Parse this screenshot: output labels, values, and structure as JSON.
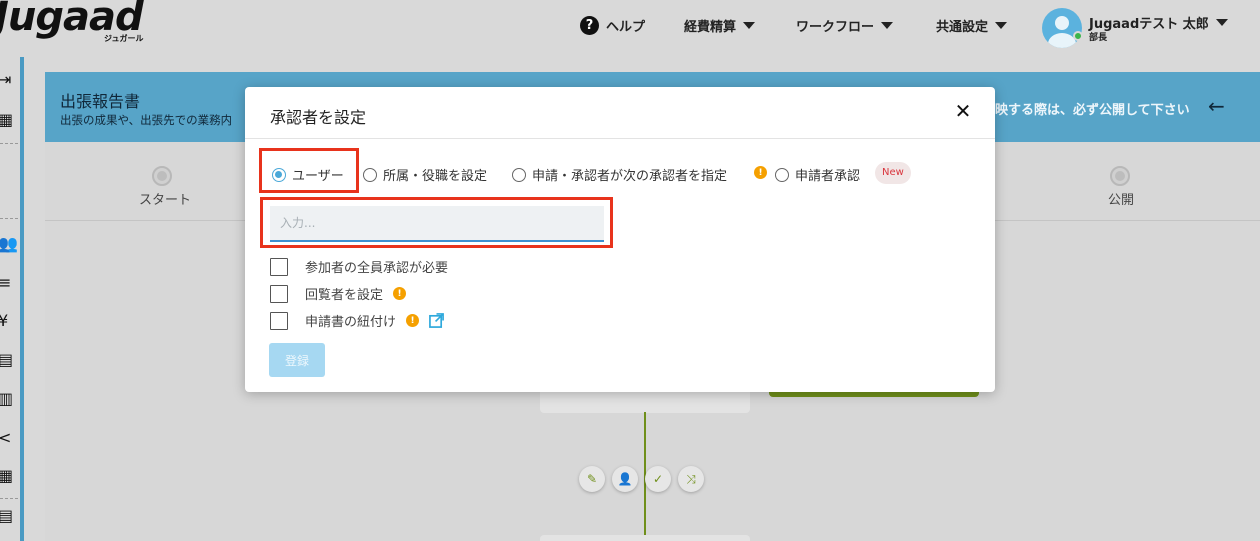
{
  "header": {
    "logo": "Jugaad",
    "logo_sub": "ジュガール",
    "help": "ヘルプ",
    "nav": [
      "経費精算",
      "ワークフロー",
      "共通設定"
    ],
    "user_name": "Jugaadテスト 太郎",
    "user_role": "部長"
  },
  "page": {
    "title": "出張報告書",
    "subtitle": "出張の成果や、出張先での業務内",
    "note": "映する際は、必ず公開して下さい",
    "step_start": "スタート",
    "step_publish": "公開"
  },
  "modal": {
    "title": "承認者を設定",
    "radios": [
      "ユーザー",
      "所属・役職を設定",
      "申請・承認者が次の承認者を指定",
      "申請者承認"
    ],
    "new_badge": "New",
    "input_placeholder": "入力...",
    "checkboxes": [
      "参加者の全員承認が必要",
      "回覧者を設定",
      "申請書の紐付け"
    ],
    "submit": "登録"
  },
  "colors": {
    "accent": "#4aa8d8",
    "highlight": "#e8331c",
    "info": "#f5a000",
    "flow": "#6f8f1a",
    "header_band": "#57a4c8"
  }
}
